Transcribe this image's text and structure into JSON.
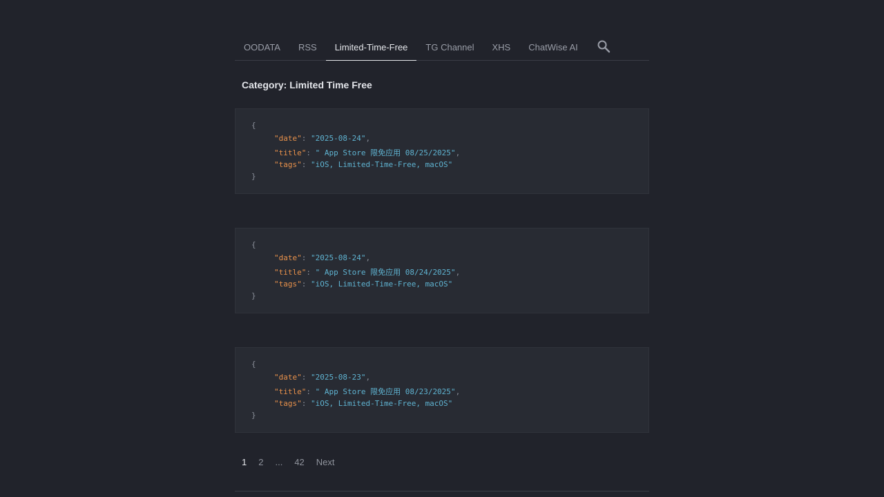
{
  "nav": {
    "items": [
      {
        "label": "OODATA"
      },
      {
        "label": "RSS"
      },
      {
        "label": "Limited-Time-Free"
      },
      {
        "label": "TG Channel"
      },
      {
        "label": "XHS"
      },
      {
        "label": "ChatWise AI"
      }
    ],
    "active_index": 2,
    "search_icon": "search-icon"
  },
  "category": {
    "title": "Category: Limited Time Free"
  },
  "json_tokens": {
    "open": "{",
    "close": "}",
    "colon": ": ",
    "comma": ",",
    "date_key": "\"date\"",
    "title_key": "\"title\"",
    "tags_key": "\"tags\""
  },
  "entries": [
    {
      "date": "\"2025-08-24\"",
      "title": "\" App Store 限免应用 08/25/2025\"",
      "tags": "\"iOS, Limited-Time-Free, macOS\""
    },
    {
      "date": "\"2025-08-24\"",
      "title": "\" App Store 限免应用 08/24/2025\"",
      "tags": "\"iOS, Limited-Time-Free, macOS\""
    },
    {
      "date": "\"2025-08-23\"",
      "title": "\" App Store 限免应用 08/23/2025\"",
      "tags": "\"iOS, Limited-Time-Free, macOS\""
    }
  ],
  "pagination": {
    "current": "1",
    "page2": "2",
    "ellipsis": "...",
    "last": "42",
    "next": "Next"
  },
  "colors": {
    "background": "#21232b",
    "card": "#282b33",
    "key": "#e8914b",
    "string": "#5fb3d1"
  }
}
